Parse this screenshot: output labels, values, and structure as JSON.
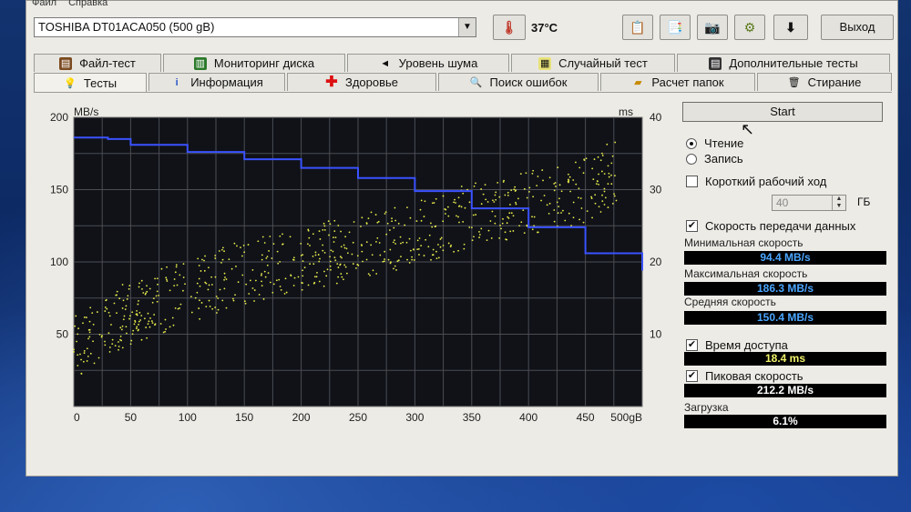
{
  "menu": [
    "Файл",
    "Справка"
  ],
  "drive": {
    "name": "TOSHIBA DT01ACA050 (500 gB)"
  },
  "temperature": "37°C",
  "exit_label": "Выход",
  "tabs_row1": [
    "Файл-тест",
    "Мониторинг диска",
    "Уровень шума",
    "Случайный тест",
    "Дополнительные тесты"
  ],
  "tabs_row2": [
    "Тесты",
    "Информация",
    "Здоровье",
    "Поиск ошибок",
    "Расчет папок",
    "Стирание"
  ],
  "start_label": "Start",
  "mode": {
    "read": "Чтение",
    "write": "Запись"
  },
  "short_stroke": {
    "label": "Короткий рабочий ход",
    "value": "40",
    "unit": "ГБ"
  },
  "transfer_rate": {
    "label": "Скорость передачи данных"
  },
  "stats": {
    "min_label": "Минимальная скорость",
    "min_value": "94.4 MB/s",
    "max_label": "Максимальная скорость",
    "max_value": "186.3 MB/s",
    "avg_label": "Средняя скорость",
    "avg_value": "150.4 MB/s",
    "access_label": "Время доступа",
    "access_value": "18.4 ms",
    "burst_label": "Пиковая скорость",
    "burst_value": "212.2 MB/s",
    "cpu_label": "Загрузка",
    "cpu_value": "6.1%"
  },
  "chart_data": {
    "type": "line",
    "y_left_unit": "MB/s",
    "y_right_unit": "ms",
    "y_left_ticks": [
      "200",
      "150",
      "100",
      "50"
    ],
    "y_right_ticks": [
      "40",
      "30",
      "20",
      "10"
    ],
    "x_ticks": [
      "0",
      "50",
      "100",
      "150",
      "200",
      "250",
      "300",
      "350",
      "400",
      "450",
      "500gB"
    ],
    "ylim_left": [
      0,
      200
    ],
    "ylim_right": [
      0,
      40
    ],
    "xlim": [
      0,
      500
    ],
    "grid": true,
    "series": [
      {
        "kind": "transfer",
        "color": "#3a52ff",
        "x": [
          0,
          30,
          50,
          100,
          150,
          200,
          250,
          300,
          350,
          400,
          450,
          500
        ],
        "y": [
          186,
          185,
          181,
          176,
          171,
          165,
          158,
          149,
          137,
          124,
          106,
          94
        ]
      },
      {
        "kind": "access",
        "color": "#e9ec4a",
        "x": [
          0,
          25,
          50,
          100,
          150,
          200,
          250,
          300,
          350,
          400,
          450,
          480
        ],
        "y": [
          8,
          11,
          13,
          16,
          18.5,
          20.5,
          22,
          24,
          26.5,
          28,
          30,
          33
        ]
      }
    ]
  }
}
